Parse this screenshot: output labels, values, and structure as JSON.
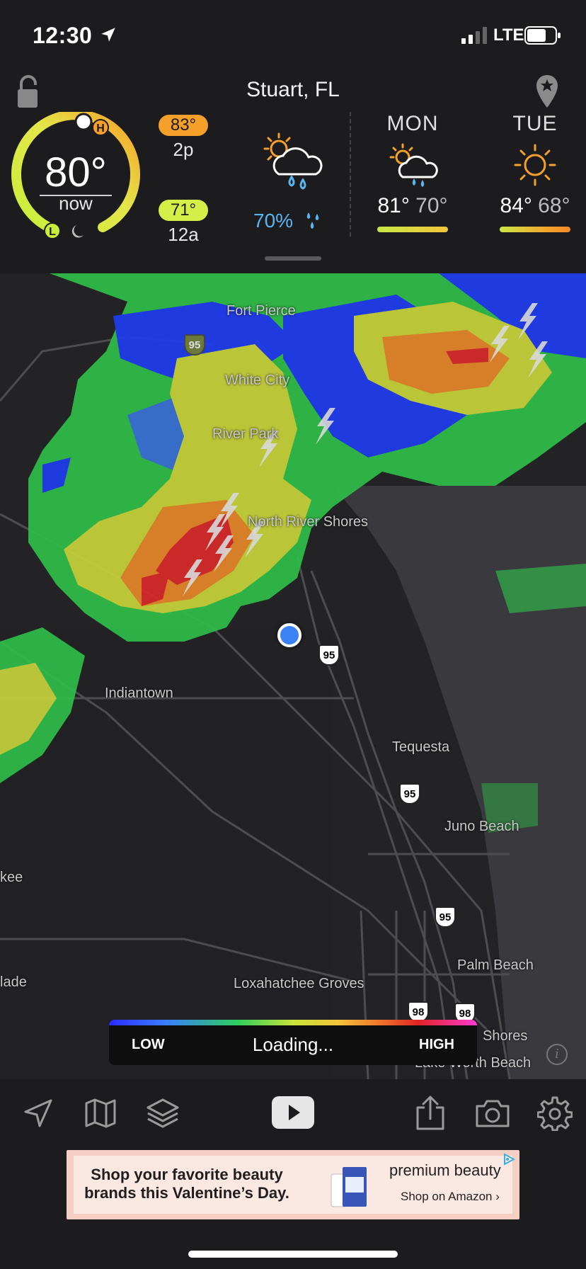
{
  "status_bar": {
    "time": "12:30",
    "carrier": "LTE"
  },
  "header": {
    "city": "Stuart, FL",
    "current_temp": "80°",
    "current_label": "now",
    "high": {
      "temp": "83°",
      "time": "2p"
    },
    "low": {
      "temp": "71°",
      "time": "12a"
    },
    "precip_chance": "70%"
  },
  "forecast": [
    {
      "day": "MON",
      "high": "81°",
      "low": "70°",
      "icon": "sun-cloud-rain-icon"
    },
    {
      "day": "TUE",
      "high": "84°",
      "low": "68°",
      "icon": "sun-icon"
    }
  ],
  "map": {
    "labels": {
      "fort_pierce": "Fort Pierce",
      "white_city": "White City",
      "river_park": "River Park",
      "north_river_shores": "North River Shores",
      "indiantown": "Indiantown",
      "tequesta": "Tequesta",
      "juno_beach": "Juno Beach",
      "okeechobee_partial": "kee",
      "belle_glade_partial": "lade",
      "loxahatchee": "Loxahatchee Groves",
      "palm_beach": "Palm Beach",
      "shores": "Shores",
      "lake_worth": "Lake Worth Beach"
    },
    "shields": {
      "i95": "95",
      "us98": "98"
    }
  },
  "legend": {
    "low": "LOW",
    "status": "Loading...",
    "high": "HIGH"
  },
  "toolbar": [
    "location-arrow-icon",
    "map-icon",
    "layers-icon",
    "play-icon",
    "share-icon",
    "camera-icon",
    "settings-icon"
  ],
  "ad": {
    "headline": "Shop your favorite beauty brands this Valentine’s Day.",
    "brand": "premium beauty",
    "cta": "Shop on Amazon ›"
  },
  "colors": {
    "high_badge": "#f5a02a",
    "low_badge": "#d4ef47",
    "precip": "#5ab4f0",
    "user_location": "#3b82f6"
  }
}
